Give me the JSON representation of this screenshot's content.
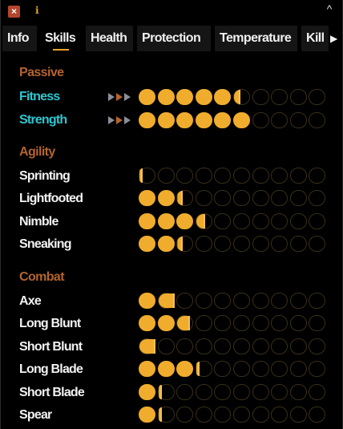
{
  "titlebar": {
    "close_label": "×",
    "info_label": "i",
    "collapse_label": "^"
  },
  "tabs": [
    {
      "label": "Info",
      "active": false
    },
    {
      "label": "Skills",
      "active": true
    },
    {
      "label": "Health",
      "active": false
    },
    {
      "label": "Protection",
      "active": false
    },
    {
      "label": "Temperature",
      "active": false
    },
    {
      "label": "Kill",
      "active": false
    }
  ],
  "tabs_more_label": "▶",
  "colors": {
    "accent": "#f0ac2d",
    "passive_skill": "#2ec7d1",
    "section_header": "#b4642d",
    "trend_colors": [
      "#b4642d",
      "#e8a82d",
      "#8a8f97"
    ]
  },
  "pips_per_skill": 10,
  "sections": [
    {
      "title": "Passive",
      "skills": [
        {
          "name": "Fitness",
          "level": 5.3,
          "passive": true,
          "trend": true
        },
        {
          "name": "Strength",
          "level": 6.0,
          "passive": true,
          "trend": true
        }
      ]
    },
    {
      "title": "Agility",
      "skills": [
        {
          "name": "Sprinting",
          "level": 0.05
        },
        {
          "name": "Lightfooted",
          "level": 2.25
        },
        {
          "name": "Nimble",
          "level": 3.45
        },
        {
          "name": "Sneaking",
          "level": 2.25
        }
      ]
    },
    {
      "title": "Combat",
      "skills": [
        {
          "name": "Axe",
          "level": 1.85
        },
        {
          "name": "Long Blunt",
          "level": 2.65
        },
        {
          "name": "Short Blunt",
          "level": 0.85
        },
        {
          "name": "Long Blade",
          "level": 3.1
        },
        {
          "name": "Short Blade",
          "level": 1.1
        },
        {
          "name": "Spear",
          "level": 1.1
        }
      ]
    }
  ]
}
